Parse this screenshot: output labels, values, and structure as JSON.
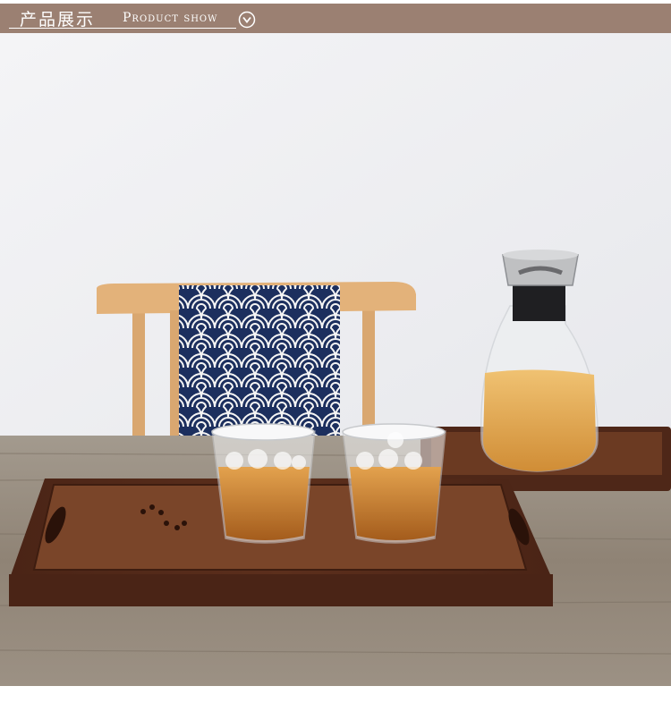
{
  "header": {
    "title_cn": "产品展示",
    "title_en": "Product show",
    "icon": "chevron-down-circle-icon",
    "bar_color": "#9b8072"
  },
  "photo": {
    "icons": [
      "wooden-tray",
      "tea-glass",
      "glass-carafe",
      "wooden-chair",
      "wave-pattern-cloth"
    ]
  }
}
